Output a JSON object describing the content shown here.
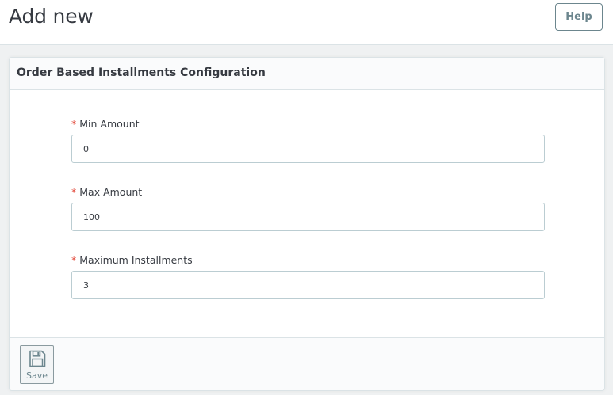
{
  "header": {
    "title": "Add new",
    "help_label": "Help"
  },
  "panel": {
    "heading": "Order Based Installments Configuration",
    "required_mark": "*",
    "fields": [
      {
        "label": "Min Amount",
        "value": "0"
      },
      {
        "label": "Max Amount",
        "value": "100"
      },
      {
        "label": "Maximum Installments",
        "value": "3"
      }
    ],
    "save_label": "Save",
    "save_icon": "floppy-disk-icon"
  },
  "colors": {
    "required": "#e24536",
    "text": "#363a41",
    "muted": "#6c868e",
    "border": "#bbcdd2",
    "background": "#eff1f2"
  }
}
